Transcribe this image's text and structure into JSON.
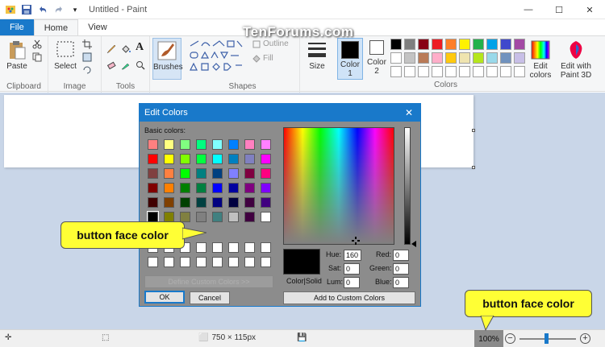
{
  "window": {
    "title": "Untitled - Paint",
    "minimize_glyph": "—",
    "maximize_glyph": "☐",
    "close_glyph": "✕"
  },
  "watermark": "TenForums.com",
  "tabs": {
    "file": "File",
    "home": "Home",
    "view": "View"
  },
  "ribbon": {
    "clipboard": {
      "paste": "Paste",
      "group": "Clipboard"
    },
    "image": {
      "select": "Select",
      "group": "Image"
    },
    "tools": {
      "group": "Tools"
    },
    "brushes": "Brushes",
    "shapes": {
      "outline": "Outline",
      "fill": "Fill",
      "group": "Shapes"
    },
    "size": "Size",
    "color1": {
      "line1": "Color",
      "line2": "1"
    },
    "color2": {
      "line1": "Color",
      "line2": "2"
    },
    "edit_colors": {
      "line1": "Edit",
      "line2": "colors"
    },
    "paint3d": {
      "line1": "Edit with",
      "line2": "Paint 3D"
    },
    "colors_group": "Colors",
    "palette_row1": [
      "#000000",
      "#7f7f7f",
      "#880015",
      "#ed1c24",
      "#ff7f27",
      "#fff200",
      "#22b14c",
      "#00a2e8",
      "#3f48cc",
      "#a349a4"
    ],
    "palette_row2": [
      "#ffffff",
      "#c3c3c3",
      "#b97a57",
      "#ffaec9",
      "#ffc90e",
      "#efe4b0",
      "#b5e61d",
      "#99d9ea",
      "#7092be",
      "#c8bfe7"
    ],
    "palette_row3": [
      "#ffffff",
      "#ffffff",
      "#ffffff",
      "#ffffff",
      "#ffffff",
      "#ffffff",
      "#ffffff",
      "#ffffff",
      "#ffffff",
      "#ffffff"
    ]
  },
  "status": {
    "dimensions": "750 × 115px",
    "zoom": "100%"
  },
  "dialog": {
    "title": "Edit Colors",
    "basic_colors_label": "Basic colors:",
    "basic_colors": [
      [
        "#ff8080",
        "#ffff80",
        "#80ff80",
        "#00ff80",
        "#80ffff",
        "#0080ff",
        "#ff80c0",
        "#ff80ff"
      ],
      [
        "#ff0000",
        "#ffff00",
        "#80ff00",
        "#00ff40",
        "#00ffff",
        "#0080c0",
        "#8080c0",
        "#ff00ff"
      ],
      [
        "#804040",
        "#ff8040",
        "#00ff00",
        "#008080",
        "#004080",
        "#8080ff",
        "#800040",
        "#ff0080"
      ],
      [
        "#800000",
        "#ff8000",
        "#008000",
        "#008040",
        "#0000ff",
        "#0000a0",
        "#800080",
        "#8000ff"
      ],
      [
        "#400000",
        "#804000",
        "#004000",
        "#004040",
        "#000080",
        "#000040",
        "#400040",
        "#400080"
      ],
      [
        "#000000",
        "#808000",
        "#808040",
        "#808080",
        "#408080",
        "#c0c0c0",
        "#400040",
        "#ffffff"
      ]
    ],
    "color_solid_label": "Color|Solid",
    "hue_label": "Hue:",
    "sat_label": "Sat:",
    "lum_label": "Lum:",
    "red_label": "Red:",
    "green_label": "Green:",
    "blue_label": "Blue:",
    "hue": "160",
    "sat": "0",
    "lum": "0",
    "red": "0",
    "green": "0",
    "blue": "0",
    "define_custom": "Define Custom Colors >>",
    "ok": "OK",
    "cancel": "Cancel",
    "add_custom": "Add to Custom Colors"
  },
  "callouts": {
    "left": "button face color",
    "right": "button face color"
  }
}
